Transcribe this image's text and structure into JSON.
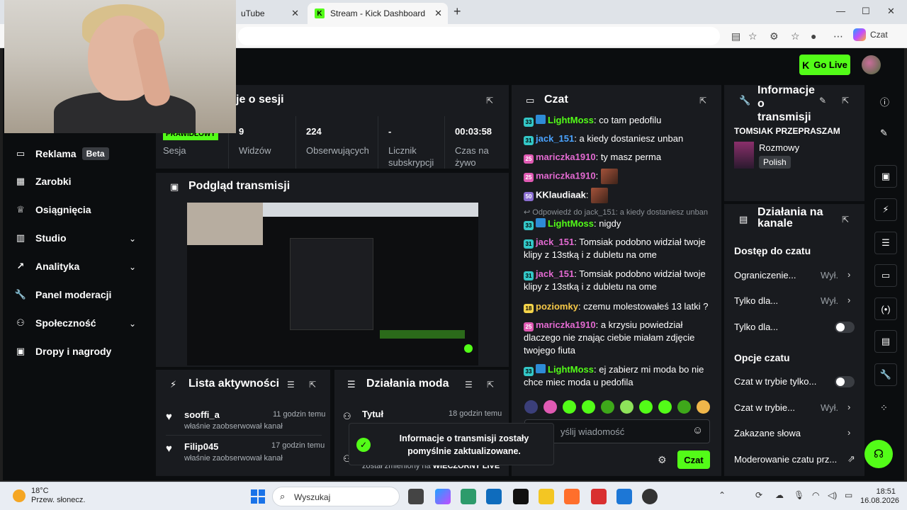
{
  "browser": {
    "tab_inactive_label": "uTube",
    "tab_active_label": "Stream - Kick Dashboard",
    "chat_ext_label": "Czat"
  },
  "header": {
    "go_live_label": "Go Live"
  },
  "sidebar": {
    "items": [
      {
        "label": "Reklama",
        "badge": "Beta"
      },
      {
        "label": "Zarobki"
      },
      {
        "label": "Osiągnięcia"
      },
      {
        "label": "Studio"
      },
      {
        "label": "Analityka"
      },
      {
        "label": "Panel moderacji"
      },
      {
        "label": "Społeczność"
      },
      {
        "label": "Dropy i nagrody"
      }
    ]
  },
  "session": {
    "title": "je o sesji",
    "live_badge": "PRAWIDŁOWY",
    "stats": [
      {
        "label": "Sesja",
        "value": ""
      },
      {
        "label": "Widzów",
        "value": "9"
      },
      {
        "label": "Obserwujących",
        "value": "224"
      },
      {
        "label": "Licznik subskrypcji",
        "value": "-"
      },
      {
        "label": "Czas na żywo",
        "value": "00:03:58"
      }
    ]
  },
  "preview": {
    "title": "Podgląd transmisji"
  },
  "activity": {
    "title": "Lista aktywności",
    "items": [
      {
        "name": "sooffi_a",
        "action": "właśnie zaobserwował kanał",
        "time": "11 godzin temu"
      },
      {
        "name": "Filip045",
        "action": "właśnie zaobserwował kanał",
        "time": "17 godzin temu"
      }
    ]
  },
  "mod_actions": {
    "title": "Działania moda",
    "items": [
      {
        "name": "Tytuł",
        "time": "18 godzin temu",
        "detail_prefix": "został zmieniony na",
        "detail_value": "WIECZORNY LIVE"
      }
    ]
  },
  "chat": {
    "title": "Czat",
    "reply_to": "Odpowiedź do jack_151: a kiedy dostaniesz unban",
    "messages": [
      {
        "badge": "33",
        "user": "LightMoss",
        "text": "co tam pedofilu"
      },
      {
        "badge": "31",
        "user": "jack_151",
        "text": "a kiedy dostaniesz unban"
      },
      {
        "badge": "25",
        "user": "mariczka1910",
        "text": "ty masz perma"
      },
      {
        "badge": "25",
        "user": "mariczka1910",
        "text": ""
      },
      {
        "badge": "50",
        "user": "KKlaudiaak",
        "text": ""
      },
      {
        "badge": "33",
        "user": "LightMoss",
        "text": "nigdy"
      },
      {
        "badge": "31",
        "user": "jack_151",
        "text": "Tomsiak podobno widział twoje klipy z 13stką i z dubletu na ome"
      },
      {
        "badge": "31",
        "user": "jack_151",
        "text": "Tomsiak podobno widział twoje klipy z 13stką i z dubletu na ome"
      },
      {
        "badge": "18",
        "user": "poziomky",
        "text": "czemu molestowałeś 13 latki ?"
      },
      {
        "badge": "25",
        "user": "mariczka1910",
        "text": "a krzysiu powiedział dlaczego nie znając ciebie miałam zdjęcie twojego fiuta"
      },
      {
        "badge": "33",
        "user": "LightMoss",
        "text": "ej zabierz mi moda bo nie chce miec moda u pedofila"
      }
    ],
    "input_placeholder": "yślij wiadomość",
    "send_label": "Czat"
  },
  "stream_info": {
    "title_lines": [
      "Informacje",
      "o",
      "transmisji"
    ],
    "stream_title": "TOMSIAK PRZEPRASZAM",
    "category": "Rozmowy",
    "language": "Polish"
  },
  "channel_actions": {
    "title_lines": [
      "Działania na",
      "kanale"
    ],
    "section_access": "Dostęp do czatu",
    "rows_access": [
      {
        "label": "Ograniczenie...",
        "value": "Wył."
      },
      {
        "label": "Tylko dla...",
        "value": "Wył."
      },
      {
        "label": "Tylko dla...",
        "value": ""
      }
    ],
    "section_options": "Opcje czatu",
    "rows_options": [
      {
        "label": "Czat w trybie tylko...",
        "value": ""
      },
      {
        "label": "Czat w trybie...",
        "value": "Wył."
      },
      {
        "label": "Zakazane słowa",
        "value": ""
      },
      {
        "label": "Moderowanie czatu prz...",
        "value": ""
      }
    ]
  },
  "toast": {
    "message": "Informacje o transmisji zostały pomyślnie zaktualizowane."
  },
  "taskbar": {
    "temperature": "18°C",
    "weather": "Przew. słonecz.",
    "search_label": "Wyszukaj",
    "time": "18:51",
    "date": "16.08.2026"
  },
  "colors": {
    "accent": "#53fc18",
    "panel": "#191b1f",
    "background": "#0b0d0f"
  }
}
